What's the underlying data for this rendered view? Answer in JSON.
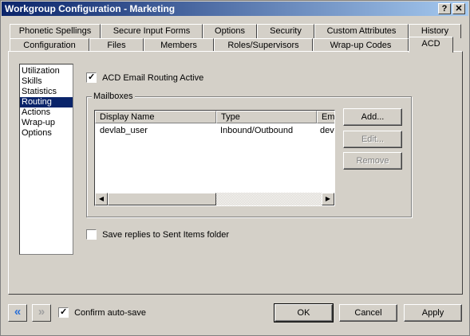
{
  "window": {
    "title": "Workgroup Configuration - Marketing",
    "help_label": "?",
    "close_label": "✕"
  },
  "tabs_row1": [
    "Phonetic Spellings",
    "Secure Input Forms",
    "Options",
    "Security",
    "Custom Attributes",
    "History"
  ],
  "tabs_row2": [
    "Configuration",
    "Files",
    "Members",
    "Roles/Supervisors",
    "Wrap-up Codes",
    "ACD"
  ],
  "active_tab": "ACD",
  "nav": {
    "items": [
      "Utilization",
      "Skills",
      "Statistics",
      "Routing",
      "Actions",
      "Wrap-up",
      "Options"
    ],
    "selected": "Routing"
  },
  "routing": {
    "acd_email_label": "ACD Email Routing Active",
    "acd_email_checked": true,
    "mailboxes_legend": "Mailboxes",
    "columns": [
      "Display Name",
      "Type",
      "Ema"
    ],
    "rows": [
      {
        "display_name": "devlab_user",
        "type": "Inbound/Outbound",
        "email": "dev"
      }
    ],
    "add_label": "Add...",
    "edit_label": "Edit...",
    "remove_label": "Remove",
    "save_replies_label": "Save replies to Sent Items folder",
    "save_replies_checked": false
  },
  "footer": {
    "back_icon": "«",
    "forward_icon": "»",
    "confirm_autosave_label": "Confirm auto-save",
    "confirm_autosave_checked": true,
    "ok_label": "OK",
    "cancel_label": "Cancel",
    "apply_label": "Apply"
  },
  "colors": {
    "titlebar_start": "#0a246a",
    "titlebar_end": "#a6caf0",
    "selection": "#0a246a",
    "nav_back_accent": "#2a6fd6"
  }
}
